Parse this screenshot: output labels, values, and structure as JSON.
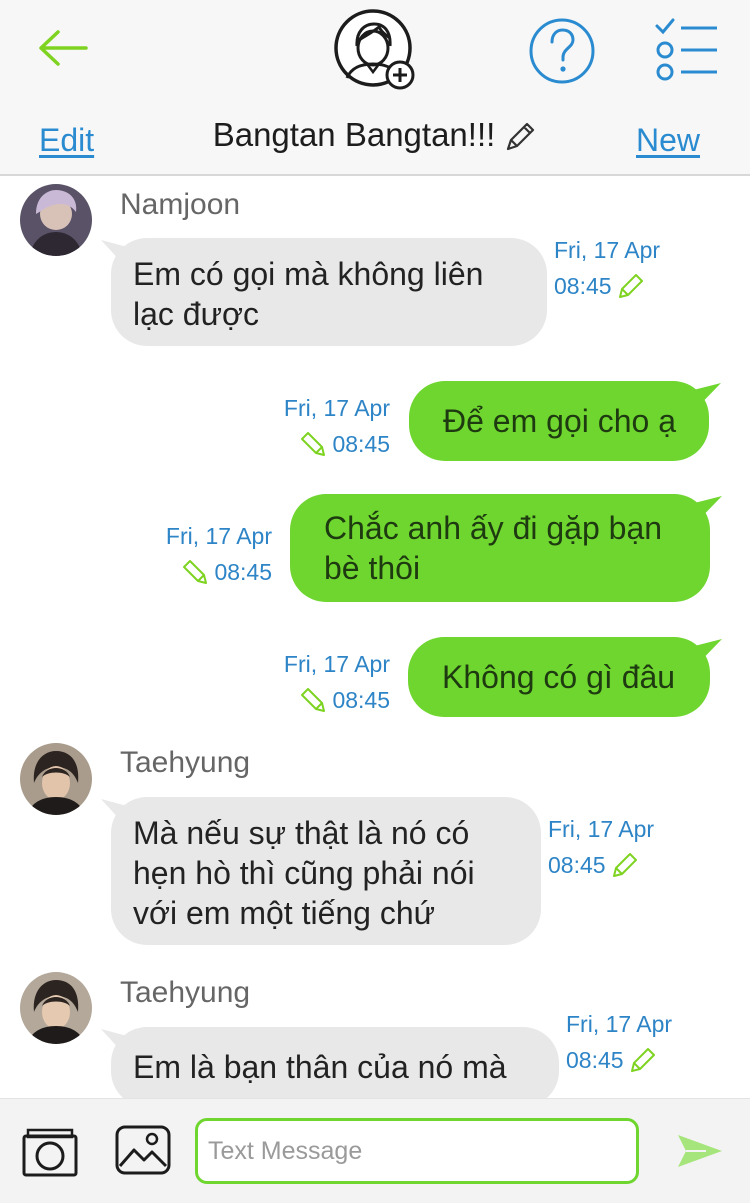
{
  "header": {
    "title": "Bangtan Bangtan!!!",
    "edit_label": "Edit",
    "new_label": "New",
    "icons": {
      "back": "arrow-left-icon",
      "group_avatar": "add-member-icon",
      "help": "question-mark-icon",
      "options": "checklist-icon",
      "edit_title": "pencil-icon"
    }
  },
  "messages": [
    {
      "direction": "in",
      "sender": "Namjoon",
      "text": "Em có gọi mà không liên lạc được",
      "date": "Fri, 17 Apr",
      "time": "08:45"
    },
    {
      "direction": "out",
      "text": "Để em gọi cho ạ",
      "date": "Fri, 17 Apr",
      "time": "08:45"
    },
    {
      "direction": "out",
      "text": "Chắc anh ấy đi gặp bạn bè thôi",
      "date": "Fri, 17 Apr",
      "time": "08:45"
    },
    {
      "direction": "out",
      "text": "Không có gì đâu",
      "date": "Fri, 17 Apr",
      "time": "08:45"
    },
    {
      "direction": "in",
      "sender": "Taehyung",
      "text": "Mà nếu sự thật là nó có hẹn hò thì cũng phải nói với em một tiếng chứ",
      "date": "Fri, 17 Apr",
      "time": "08:45"
    },
    {
      "direction": "in",
      "sender": "Taehyung",
      "text": "Em là bạn thân của nó mà",
      "date": "Fri, 17 Apr",
      "time": "08:45"
    }
  ],
  "composer": {
    "placeholder": "Text Message",
    "icons": {
      "camera": "camera-icon",
      "gallery": "image-icon",
      "send": "send-icon"
    }
  },
  "colors": {
    "accent_blue": "#2b8bd0",
    "back_arrow_green": "#7ed321",
    "outgoing_bubble": "#6fd62f",
    "incoming_bubble": "#e8e8e8"
  }
}
